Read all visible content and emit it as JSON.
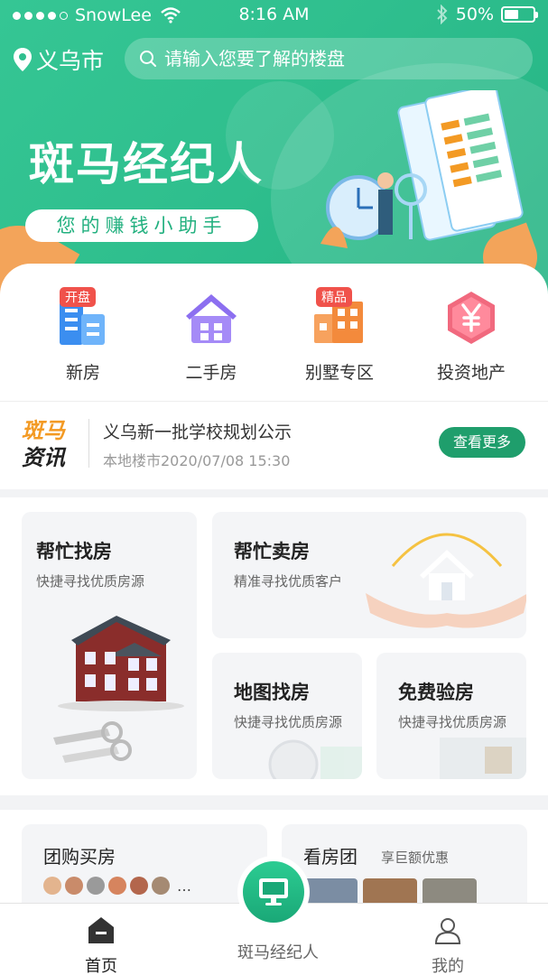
{
  "status_bar": {
    "carrier": "SnowLee",
    "time": "8:16 AM",
    "battery": "50%",
    "battery_level": 0.5
  },
  "header": {
    "city": "义乌市",
    "search_placeholder": "请输入您要了解的楼盘"
  },
  "banner": {
    "title": "斑马经纪人",
    "slogan": "您的赚钱小助手"
  },
  "categories": [
    {
      "label": "新房",
      "tag": "开盘",
      "icon": "building-icon"
    },
    {
      "label": "二手房",
      "tag": "",
      "icon": "house-icon"
    },
    {
      "label": "别墅专区",
      "tag": "精品",
      "icon": "villa-icon"
    },
    {
      "label": "投资地产",
      "tag": "",
      "icon": "yuan-icon"
    }
  ],
  "news": {
    "logo_line1": "斑马",
    "logo_line2": "资讯",
    "title": "义乌新一批学校规划公示",
    "meta": "本地楼市2020/07/08 15:30",
    "more_label": "查看更多"
  },
  "services": [
    {
      "title": "帮忙找房",
      "desc": "快捷寻找优质房源"
    },
    {
      "title": "帮忙卖房",
      "desc": "精准寻找优质客户"
    },
    {
      "title": "地图找房",
      "desc": "快捷寻找优质房源"
    },
    {
      "title": "免费验房",
      "desc": "快捷寻找优质房源"
    }
  ],
  "bottom_cards": {
    "group_buy": {
      "title": "团购买房",
      "ellipsis": "…"
    },
    "tour": {
      "title": "看房团",
      "subtitle": "享巨额优惠"
    }
  },
  "tabbar": {
    "home": "首页",
    "center": "斑马经纪人",
    "me": "我的"
  },
  "colors": {
    "brand_green": "#2fbf8e",
    "accent_orange": "#f39a24",
    "tag_red": "#f0524b",
    "button_green": "#1f9e6c"
  }
}
